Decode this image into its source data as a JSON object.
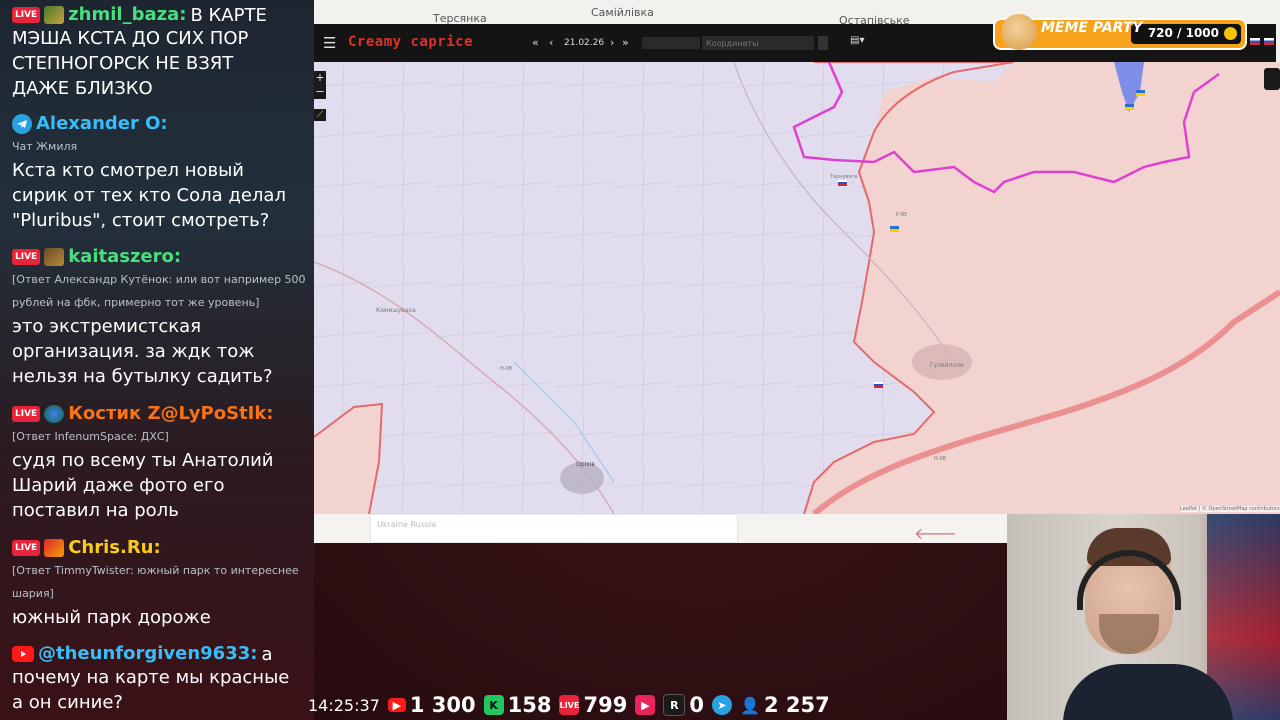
{
  "chat": {
    "messages": [
      {
        "user": "zhmil_baza:",
        "text_inline": "В КАРТЕ",
        "text": [
          "МЭША КСТА ДО СИХ ПОР",
          "СТЕПНОГОРСК НЕ ВЗЯТ",
          "ДАЖЕ БЛИЗКО"
        ],
        "platform": "live",
        "color": "#4ade80"
      },
      {
        "user": "Alexander O:",
        "subtitle": "Чат Жмиля",
        "text": [
          "Кста кто смотрел новый",
          "сирик от тех кто Сола делал",
          "\"Pluribus\", стоит смотреть?"
        ],
        "platform": "telegram",
        "color": "#38bdf8"
      },
      {
        "user": "kaitaszero:",
        "subtitle_lines": [
          "[Ответ Александр Кутёнок: или вот например 500",
          "рублей на фбк, примерно тот же уровень]"
        ],
        "text": [
          "это экстремистская",
          "организация. за ждк тож",
          "нельзя на бутылку садить?"
        ],
        "platform": "live",
        "color": "#4ade80"
      },
      {
        "user": "Костик Z@LyPoStIk:",
        "subtitle": "[Ответ InfenumSpace: ДХС]",
        "text": [
          "судя по всему ты Анатолий",
          "Шарий даже фото его",
          "поставил на роль"
        ],
        "platform": "live",
        "color": "#f97316"
      },
      {
        "user": "Chris.Ru:",
        "subtitle_lines": [
          "[Ответ TimmyTwister: южный парк то интереснее",
          "шария]"
        ],
        "text": [
          "южный парк дороже"
        ],
        "platform": "live",
        "color": "#facc15"
      },
      {
        "user": "@theunforgiven9633:",
        "text_inline": "а",
        "text": [
          "почему на карте мы красные",
          "а он синие?"
        ],
        "platform": "youtube",
        "color": "#38bdf8"
      }
    ]
  },
  "map": {
    "brand": "Creamy caprice",
    "date": "21.02.26",
    "coords_placeholder": "Координаты",
    "zoom_in": "+",
    "zoom_out": "−",
    "attribution": "Leaflet | © OpenStreetMap contributors",
    "labels": {
      "tersyanka": "Терсянка",
      "samiylivka": "Самійлівка",
      "ostapivske": "Остапівське",
      "kamyshuvakha": "Камишуваха",
      "orikhiv": "Оріхів",
      "huliaipole": "Гуляйполе",
      "road_n08": "Н-08",
      "road_r85": "Р-85",
      "road_n08b": "H-08",
      "tsarivka": "Тернувате"
    },
    "strip_text": "Ukraine Russia"
  },
  "meme_party": {
    "title": "MEME PARTY",
    "progress": "720 / 1000",
    "progress_value": 720,
    "progress_max": 1000
  },
  "stats": {
    "time": "14:25:37",
    "youtube": "1 300",
    "kick": "158",
    "live": "799",
    "rutube": "0",
    "telegram": "2 257"
  },
  "icons": [
    "live-badge",
    "telegram-icon",
    "youtube-icon",
    "kick-icon",
    "rutube-icon",
    "viewers-icon",
    "arrow-left-icon",
    "layers-icon",
    "menu-icon"
  ]
}
